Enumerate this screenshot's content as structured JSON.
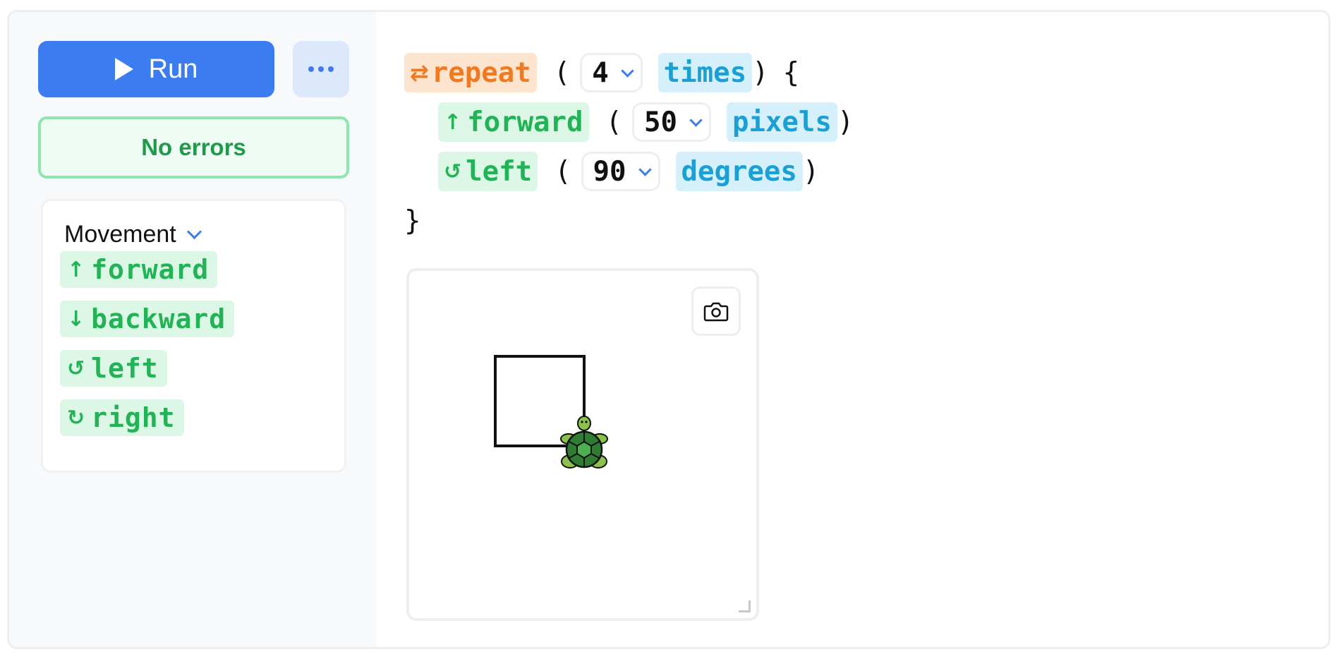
{
  "toolbar": {
    "run_label": "Run",
    "more_label": "More options"
  },
  "status": {
    "text": "No errors",
    "color": "#1e9a4b"
  },
  "palette": {
    "category": "Movement",
    "blocks": [
      {
        "icon": "up-arrow-icon",
        "glyph": "↑",
        "label": "forward"
      },
      {
        "icon": "down-arrow-icon",
        "glyph": "↓",
        "label": "backward"
      },
      {
        "icon": "rotate-left-icon",
        "glyph": "↺",
        "label": "left"
      },
      {
        "icon": "rotate-right-icon",
        "glyph": "↻",
        "label": "right"
      }
    ]
  },
  "code": {
    "repeat": {
      "icon": "loop-icon",
      "glyph": "⇄",
      "keyword": "repeat",
      "value": "4",
      "unit": "times",
      "open": "(",
      "close": ")",
      "brace": "{"
    },
    "forward": {
      "icon": "up-arrow-icon",
      "glyph": "↑",
      "keyword": "forward",
      "value": "50",
      "unit": "pixels",
      "open": "(",
      "close": ")"
    },
    "left": {
      "icon": "rotate-left-icon",
      "glyph": "↺",
      "keyword": "left",
      "value": "90",
      "unit": "degrees",
      "open": "(",
      "close": ")"
    },
    "end_brace": "}"
  },
  "canvas": {
    "camera_icon": "camera-icon",
    "turtle_icon": "turtle-icon"
  },
  "colors": {
    "accent": "#3b7df0",
    "loop": "#f07a22",
    "motion": "#23b357",
    "unit": "#1aa0d6"
  }
}
